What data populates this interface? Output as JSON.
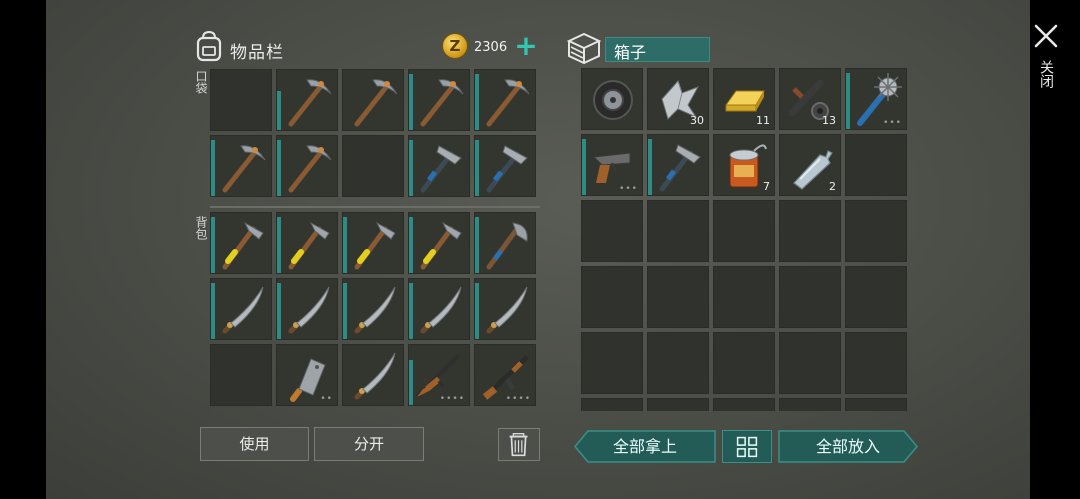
{
  "header": {
    "inventory_title": "物品栏",
    "coin_symbol": "Z",
    "coins": "2306",
    "plus_label": "+",
    "box_title": "箱子",
    "close_label": "关闭"
  },
  "sections": {
    "pocket_label": "口袋",
    "backpack_label": "背包"
  },
  "colors": {
    "accent_teal": "#2e8c86",
    "panel_bg": "#4a4c46",
    "slot_bg": "#33362f"
  },
  "pocket_slots": [
    {
      "item": "empty"
    },
    {
      "item": "pickaxe",
      "icon": "pickaxe-icon",
      "durability": 0.7
    },
    {
      "item": "pickaxe",
      "icon": "pickaxe-icon",
      "durability": 0
    },
    {
      "item": "pickaxe",
      "icon": "pickaxe-icon",
      "durability": 1
    },
    {
      "item": "pickaxe",
      "icon": "pickaxe-icon",
      "durability": 1
    },
    {
      "item": "pickaxe",
      "icon": "pickaxe-icon",
      "durability": 1
    },
    {
      "item": "pickaxe",
      "icon": "pickaxe-icon",
      "durability": 1
    },
    {
      "item": "empty"
    },
    {
      "item": "iron-pickaxe",
      "icon": "iron-pickaxe-icon",
      "durability": 1
    },
    {
      "item": "iron-pickaxe",
      "icon": "iron-pickaxe-icon",
      "durability": 1
    }
  ],
  "backpack_slots": [
    {
      "item": "hatchet",
      "icon": "hatchet-icon",
      "durability": 1
    },
    {
      "item": "hatchet",
      "icon": "hatchet-icon",
      "durability": 1
    },
    {
      "item": "hatchet",
      "icon": "hatchet-icon",
      "durability": 1
    },
    {
      "item": "hatchet",
      "icon": "hatchet-icon",
      "durability": 1
    },
    {
      "item": "iron-axe",
      "icon": "iron-axe-icon",
      "durability": 1
    },
    {
      "item": "machete",
      "icon": "machete-icon",
      "durability": 1
    },
    {
      "item": "machete",
      "icon": "machete-icon",
      "durability": 1
    },
    {
      "item": "machete",
      "icon": "machete-icon",
      "durability": 1
    },
    {
      "item": "machete",
      "icon": "machete-icon",
      "durability": 1
    },
    {
      "item": "machete",
      "icon": "machete-icon",
      "durability": 1
    },
    {
      "item": "empty"
    },
    {
      "item": "cleaver",
      "icon": "cleaver-icon",
      "durability": 0,
      "dots": "••"
    },
    {
      "item": "machete",
      "icon": "machete-icon",
      "durability": 0
    },
    {
      "item": "rifle",
      "icon": "rifle-icon",
      "durability": 0.8,
      "dots": "••••"
    },
    {
      "item": "assault-rifle",
      "icon": "assault-rifle-icon",
      "durability": 0,
      "dots": "••••"
    }
  ],
  "box_slots": [
    {
      "item": "tire",
      "icon": "tire-icon"
    },
    {
      "item": "metal-scrap",
      "icon": "metal-scrap-icon",
      "count": "30"
    },
    {
      "item": "gold-bar",
      "icon": "gold-bar-icon",
      "count": "11"
    },
    {
      "item": "mechanical-parts",
      "icon": "parts-icon",
      "count": "13"
    },
    {
      "item": "spiked-club",
      "icon": "spiked-club-icon",
      "durability": 1,
      "dots": "•••"
    },
    {
      "item": "flare-gun",
      "icon": "flare-gun-icon",
      "durability": 1,
      "dots": "•••"
    },
    {
      "item": "iron-pickaxe",
      "icon": "iron-pickaxe-icon",
      "durability": 1
    },
    {
      "item": "canned-food",
      "icon": "canned-food-icon",
      "count": "7"
    },
    {
      "item": "water-bottle",
      "icon": "water-bottle-icon",
      "count": "2"
    },
    {
      "item": "empty"
    }
  ],
  "buttons": {
    "use": "使用",
    "split": "分开",
    "take_all": "全部拿上",
    "put_all": "全部放入"
  }
}
